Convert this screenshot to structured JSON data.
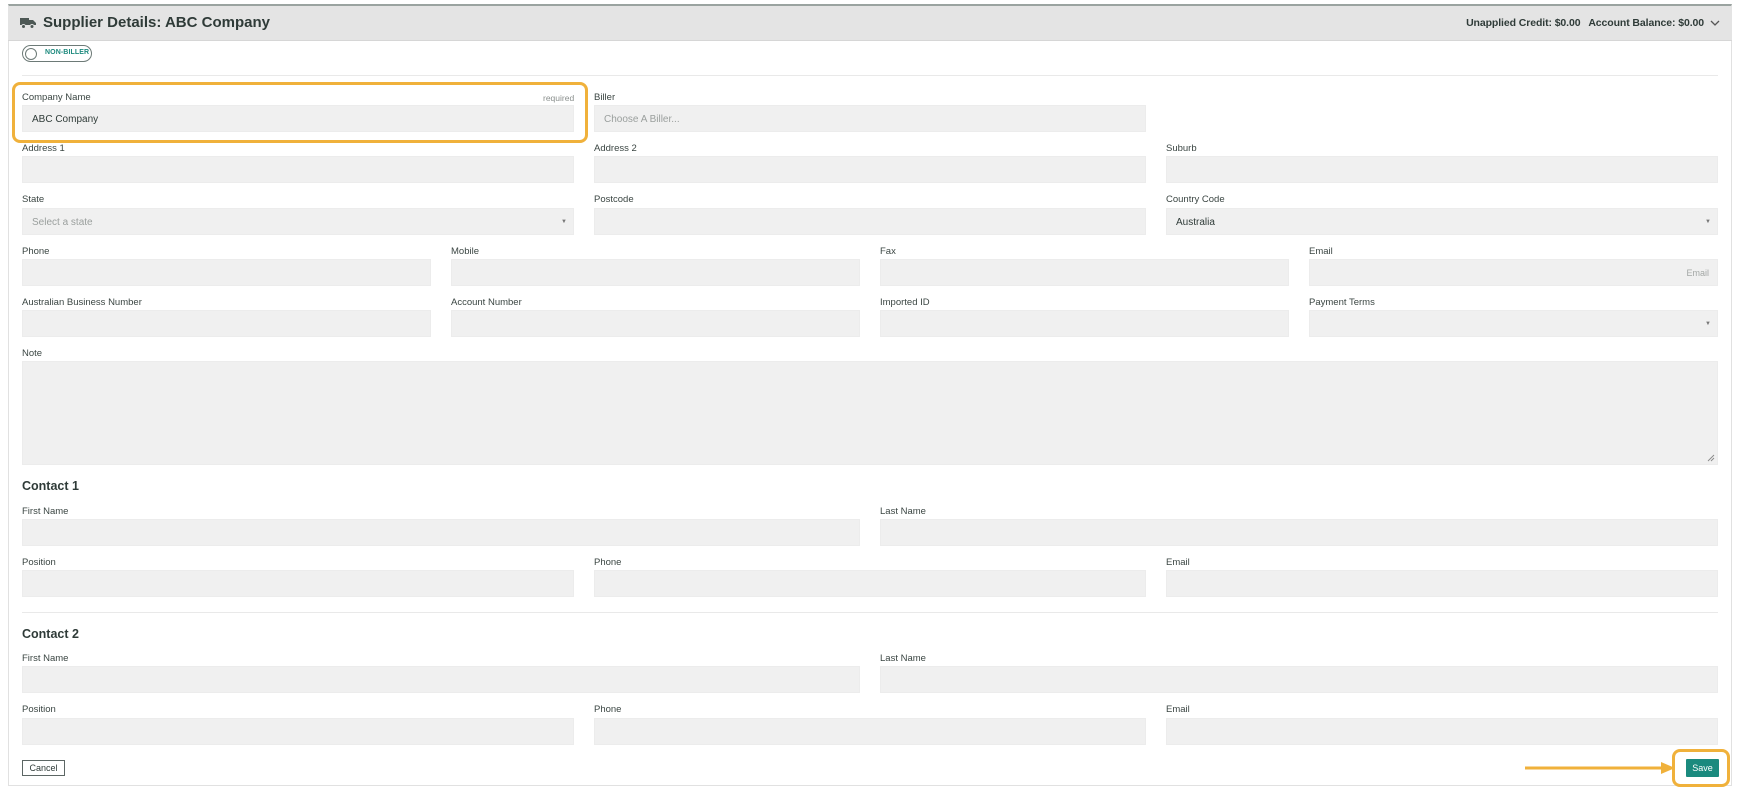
{
  "header": {
    "title": "Supplier Details: ABC Company",
    "unapplied_credit": "Unapplied Credit: $0.00",
    "account_balance": "Account Balance: $0.00",
    "icon": "truck-icon",
    "collapse_icon": "chevron-down-icon"
  },
  "toggle": {
    "label": "NON-BILLER",
    "checked": false
  },
  "company": {
    "label": "Company Name",
    "required": "required",
    "value": "ABC Company"
  },
  "biller": {
    "label": "Biller",
    "placeholder": "Choose A Biller..."
  },
  "address1": {
    "label": "Address 1",
    "value": ""
  },
  "address2": {
    "label": "Address 2",
    "value": ""
  },
  "suburb": {
    "label": "Suburb",
    "value": ""
  },
  "state": {
    "label": "State",
    "placeholder": "Select a state"
  },
  "postcode": {
    "label": "Postcode",
    "value": ""
  },
  "country": {
    "label": "Country Code",
    "value": "Australia"
  },
  "phone": {
    "label": "Phone",
    "value": ""
  },
  "mobile": {
    "label": "Mobile",
    "value": ""
  },
  "fax": {
    "label": "Fax",
    "value": ""
  },
  "email": {
    "label": "Email",
    "placeholder": "Email"
  },
  "abn": {
    "label": "Australian Business Number",
    "value": ""
  },
  "account_number": {
    "label": "Account Number",
    "value": ""
  },
  "imported_id": {
    "label": "Imported ID",
    "value": ""
  },
  "payment_terms": {
    "label": "Payment Terms",
    "value": ""
  },
  "note": {
    "label": "Note",
    "value": ""
  },
  "contact1": {
    "title": "Contact 1",
    "first_name": "First Name",
    "last_name": "Last Name",
    "position": "Position",
    "phone": "Phone",
    "email": "Email"
  },
  "contact2": {
    "title": "Contact 2",
    "first_name": "First Name",
    "last_name": "Last Name",
    "position": "Position",
    "phone": "Phone",
    "email": "Email"
  },
  "actions": {
    "cancel": "Cancel",
    "save": "Save"
  },
  "colors": {
    "accent": "#1a8a7e",
    "highlight": "#f0b13b",
    "field_bg": "#f0f0f0",
    "header_bg": "#e4e4e4"
  }
}
